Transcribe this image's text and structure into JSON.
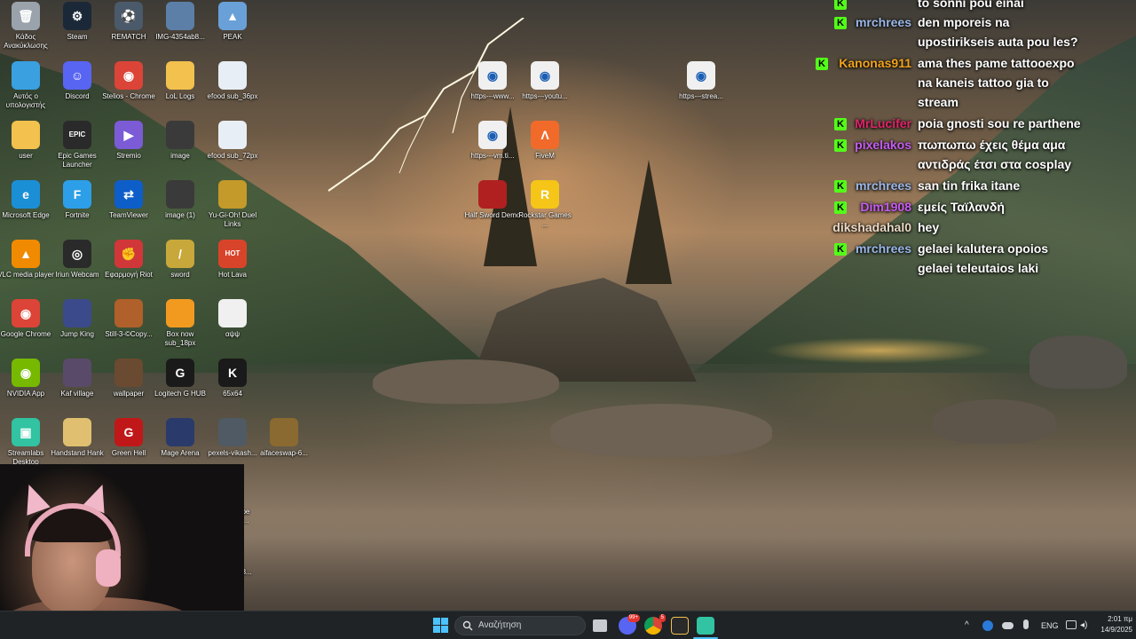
{
  "desktop": {
    "icons": [
      {
        "label": "Κάδος Ανακύκλωσης",
        "icon": "recycle-bin-icon",
        "color": "#9aa3ab",
        "glyph": "🗑"
      },
      {
        "label": "Steam",
        "icon": "steam-icon",
        "color": "#1b2838",
        "glyph": "⚙"
      },
      {
        "label": "REMATCH",
        "icon": "rematch-icon",
        "color": "#4a5a6a",
        "glyph": "⚽"
      },
      {
        "label": "IMG-4354ab8...",
        "icon": "image-file-icon",
        "color": "#5c7fa8",
        "glyph": ""
      },
      {
        "label": "PEAK",
        "icon": "peak-icon",
        "color": "#6aa0d8",
        "glyph": "▲"
      },
      {
        "label": "Αυτός ο υπολογιστής",
        "icon": "this-pc-icon",
        "color": "#3aa0e0",
        "glyph": ""
      },
      {
        "label": "Discord",
        "icon": "discord-icon",
        "color": "#5865f2",
        "glyph": "☺"
      },
      {
        "label": "Stelios - Chrome",
        "icon": "chrome-profile-icon",
        "color": "#db4437",
        "glyph": "◉"
      },
      {
        "label": "LoL Logs",
        "icon": "folder-icon",
        "color": "#f2c14e",
        "glyph": ""
      },
      {
        "label": "efood sub_36px",
        "icon": "image-file-icon",
        "color": "#e8eef5",
        "glyph": ""
      },
      {
        "label": "user",
        "icon": "folder-icon",
        "color": "#f2c14e",
        "glyph": ""
      },
      {
        "label": "Epic Games Launcher",
        "icon": "epic-games-icon",
        "color": "#2a2a2a",
        "glyph": "EPIC"
      },
      {
        "label": "Stremio",
        "icon": "stremio-icon",
        "color": "#7b5bd6",
        "glyph": "▶"
      },
      {
        "label": "image",
        "icon": "image-file-icon",
        "color": "#3a3a3a",
        "glyph": ""
      },
      {
        "label": "efood sub_72px",
        "icon": "image-file-icon",
        "color": "#e8eef5",
        "glyph": ""
      },
      {
        "label": "Microsoft Edge",
        "icon": "edge-icon",
        "color": "#1b8fd6",
        "glyph": "e"
      },
      {
        "label": "Fortnite",
        "icon": "fortnite-icon",
        "color": "#2d9fe8",
        "glyph": "F"
      },
      {
        "label": "TeamViewer",
        "icon": "teamviewer-icon",
        "color": "#0e5ec9",
        "glyph": "⇄"
      },
      {
        "label": "image (1)",
        "icon": "image-file-icon",
        "color": "#3a3a3a",
        "glyph": ""
      },
      {
        "label": "Yu-Gi-Oh! Duel Links",
        "icon": "yugioh-icon",
        "color": "#c49a2a",
        "glyph": ""
      },
      {
        "label": "VLC media player",
        "icon": "vlc-icon",
        "color": "#f08a00",
        "glyph": "▲"
      },
      {
        "label": "Iriun Webcam",
        "icon": "iriun-webcam-icon",
        "color": "#2a2a2a",
        "glyph": "◎"
      },
      {
        "label": "Εφαρμογή Riot",
        "icon": "riot-icon",
        "color": "#d13639",
        "glyph": "✊"
      },
      {
        "label": "sword",
        "icon": "sword-icon",
        "color": "#c8a83a",
        "glyph": "/"
      },
      {
        "label": "Hot Lava",
        "icon": "hot-lava-icon",
        "color": "#d8442a",
        "glyph": "HOT"
      },
      {
        "label": "Google Chrome",
        "icon": "chrome-icon",
        "color": "#db4437",
        "glyph": "◉"
      },
      {
        "label": "Jump King",
        "icon": "jump-king-icon",
        "color": "#3b4a8a",
        "glyph": ""
      },
      {
        "label": "Still-3-©Copy...",
        "icon": "image-file-icon",
        "color": "#b0602a",
        "glyph": ""
      },
      {
        "label": "Box now sub_18px",
        "icon": "image-file-icon",
        "color": "#f29a20",
        "glyph": ""
      },
      {
        "label": "αψψ",
        "icon": "text-file-icon",
        "color": "#f0f0f0",
        "glyph": ""
      },
      {
        "label": "NVIDIA App",
        "icon": "nvidia-icon",
        "color": "#76b900",
        "glyph": "◉"
      },
      {
        "label": "Kaf village",
        "icon": "image-file-icon",
        "color": "#5a4a6a",
        "glyph": ""
      },
      {
        "label": "wallpaper",
        "icon": "image-file-icon",
        "color": "#6a4a30",
        "glyph": ""
      },
      {
        "label": "Logitech G HUB",
        "icon": "logitech-icon",
        "color": "#1a1a1a",
        "glyph": "G"
      },
      {
        "label": "65x64",
        "icon": "kick-icon",
        "color": "#1a1a1a",
        "glyph": "K"
      },
      {
        "label": "Streamlabs Desktop",
        "icon": "streamlabs-icon",
        "color": "#31c3a2",
        "glyph": "▣"
      },
      {
        "label": "Handstand Hank",
        "icon": "handstand-hank-icon",
        "color": "#e0c070",
        "glyph": ""
      },
      {
        "label": "Green Hell",
        "icon": "green-hell-icon",
        "color": "#c01818",
        "glyph": "G"
      },
      {
        "label": "Mage Arena",
        "icon": "mage-arena-icon",
        "color": "#2a3a6a",
        "glyph": ""
      },
      {
        "label": "pexels-vikash...",
        "icon": "image-file-icon",
        "color": "#505a64",
        "glyph": ""
      },
      {
        "label": "aifaceswap-6...",
        "icon": "image-file-icon",
        "color": "#8a6a30",
        "glyph": ""
      },
      {
        "label": "https---www...",
        "icon": "chrome-shortcut-icon",
        "color": "#f0f0f0",
        "glyph": "◉"
      },
      {
        "label": "https---youtu...",
        "icon": "chrome-shortcut-icon",
        "color": "#f0f0f0",
        "glyph": "◉"
      },
      {
        "label": "https---strea...",
        "icon": "chrome-shortcut-icon",
        "color": "#f0f0f0",
        "glyph": "◉"
      },
      {
        "label": "https---vm.ti...",
        "icon": "chrome-shortcut-icon",
        "color": "#f0f0f0",
        "glyph": "◉"
      },
      {
        "label": "FiveM",
        "icon": "fivem-icon",
        "color": "#f26a2a",
        "glyph": "Λ"
      },
      {
        "label": "Half Sword Demo",
        "icon": "half-sword-icon",
        "color": "#b02020",
        "glyph": ""
      },
      {
        "label": "Rockstar Games ...",
        "icon": "rockstar-icon",
        "color": "#f5c518",
        "glyph": "R"
      }
    ],
    "partial_labels": [
      "ape",
      "D...",
      "28..."
    ]
  },
  "chat": {
    "badge": "K",
    "badge_color": "#53fc18",
    "messages": [
      {
        "user": "",
        "user_color": "#2ad17b",
        "text": "to sonni pou einai",
        "badge": true
      },
      {
        "user": "mrchrees",
        "user_color": "#9bb8e8",
        "text": "den mporeis na upostirikseis auta pou les?",
        "badge": true
      },
      {
        "user": "Kanonas911",
        "user_color": "#f2a31b",
        "text": "ama thes pame tattooexpo na kaneis tattoo gia to stream",
        "badge": true
      },
      {
        "user": "MrLucifer",
        "user_color": "#e0246a",
        "text": "poia gnosti sou re parthene",
        "badge": true
      },
      {
        "user": "pixelakos",
        "user_color": "#c45cf2",
        "text": "πωπωπω έχεις θέμα αμα αντιδράς έτσι στα cosplay",
        "badge": true
      },
      {
        "user": "mrchrees",
        "user_color": "#9bb8e8",
        "text": "san tin frika itane",
        "badge": true
      },
      {
        "user": "Dim1908",
        "user_color": "#c45cf2",
        "text": "εμείς Ταϊλανδή",
        "badge": true
      },
      {
        "user": "dikshadahal0",
        "user_color": "#e9d8c4",
        "text": "hey",
        "badge": false
      },
      {
        "user": "mrchrees",
        "user_color": "#9bb8e8",
        "text": "gelaei kalutera opoios gelaei teleutaios laki",
        "badge": true
      }
    ]
  },
  "taskbar": {
    "search_placeholder": "Αναζήτηση",
    "discord_badge": "99+",
    "chrome_badge": "5",
    "language": "ENG",
    "time": "2:01 πμ",
    "date": "14/9/2025",
    "accent_color": "#4cc2ff"
  }
}
